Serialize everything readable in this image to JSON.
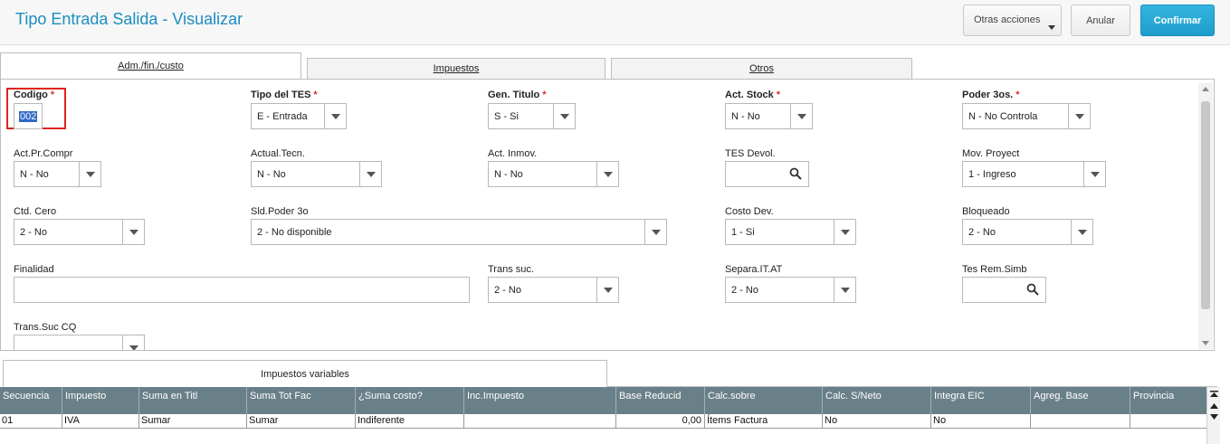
{
  "header": {
    "title": "Tipo Entrada Salida - Visualizar",
    "otras_acciones": "Otras acciones",
    "anular": "Anular",
    "confirmar": "Confirmar"
  },
  "tabs": [
    {
      "label": "Adm./fin./custo"
    },
    {
      "label": "Impuestos"
    },
    {
      "label": "Otros"
    }
  ],
  "fields": {
    "codigo": {
      "label": "Codigo",
      "value": "002"
    },
    "tipo_tes": {
      "label": "Tipo del TES",
      "value": "E - Entrada"
    },
    "gen_titulo": {
      "label": "Gen. Titulo",
      "value": "S - Si"
    },
    "act_stock": {
      "label": "Act. Stock",
      "value": "N - No"
    },
    "poder_3os": {
      "label": "Poder 3os.",
      "value": "N - No Controla"
    },
    "act_pr_compr": {
      "label": "Act.Pr.Compr",
      "value": "N - No"
    },
    "actual_tecn": {
      "label": "Actual.Tecn.",
      "value": "N - No"
    },
    "act_inmov": {
      "label": "Act. Inmov.",
      "value": "N - No"
    },
    "tes_devol": {
      "label": "TES Devol.",
      "value": ""
    },
    "mov_proyect": {
      "label": "Mov. Proyect",
      "value": "1 - Ingreso"
    },
    "ctd_cero": {
      "label": "Ctd. Cero",
      "value": "2 - No"
    },
    "sld_poder_3o": {
      "label": "Sld.Poder 3o",
      "value": "2 - No disponible"
    },
    "costo_dev": {
      "label": "Costo Dev.",
      "value": "1 - Si"
    },
    "bloqueado": {
      "label": "Bloqueado",
      "value": "2 - No"
    },
    "finalidad": {
      "label": "Finalidad",
      "value": ""
    },
    "trans_suc": {
      "label": "Trans suc.",
      "value": "2 - No"
    },
    "separa_it_at": {
      "label": "Separa.IT.AT",
      "value": "2 - No"
    },
    "tes_rem_simb": {
      "label": "Tes Rem.Simb",
      "value": ""
    },
    "trans_suc_cq": {
      "label": "Trans.Suc CQ",
      "value": ""
    }
  },
  "bottom_tab": {
    "label": "Impuestos variables"
  },
  "grid": {
    "columns": [
      "Secuencia",
      "Impuesto",
      "Suma en Titl",
      "Suma Tot Fac",
      "¿Suma costo?",
      "Inc.Impuesto",
      "Base Reducid",
      "Calc.sobre",
      "Calc. S/Neto",
      "Integra EIC",
      "Agreg. Base",
      "Provincia"
    ],
    "rows": [
      [
        "01",
        "IVA",
        "Sumar",
        "Sumar",
        "Indiferente",
        "",
        "0,00",
        "Ítems Factura",
        "No",
        "No",
        "",
        ""
      ]
    ]
  },
  "colors": {
    "title": "#1c8dbf",
    "confirm_button": "#1f9dcc",
    "required_star": "#d9302f",
    "grid_header": "#6a8088",
    "highlight_border": "#e0231e"
  }
}
